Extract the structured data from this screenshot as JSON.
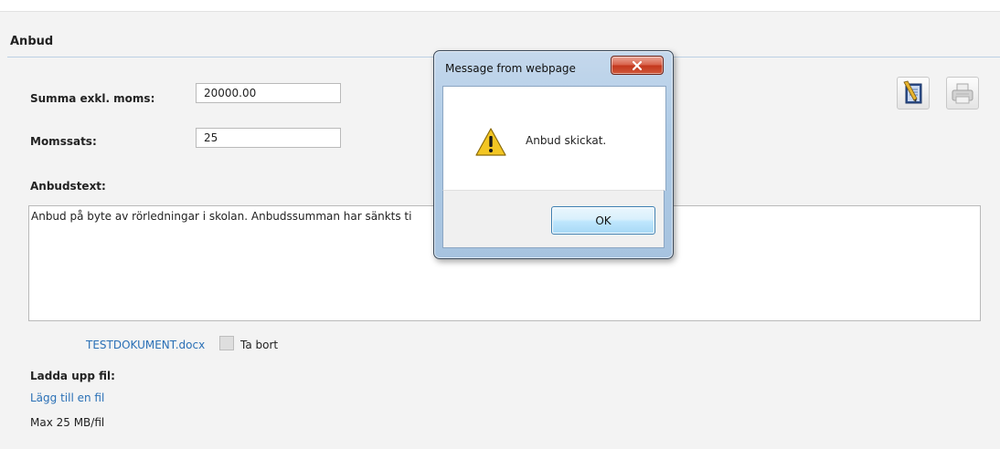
{
  "section": {
    "title": "Anbud"
  },
  "form": {
    "sum_label": "Summa exkl. moms:",
    "sum_value": "20000.00",
    "vat_label": "Momssats:",
    "vat_value": "25",
    "text_label": "Anbudstext:",
    "text_value": "Anbud på byte av rörledningar i skolan. Anbudssumman har sänkts ti"
  },
  "attachment": {
    "file_name": "TESTDOKUMENT.docx",
    "remove_label": "Ta bort",
    "remove_checked": false
  },
  "upload": {
    "label": "Ladda upp fil:",
    "add_link": "Lägg till en fil",
    "limit": "Max 25 MB/fil"
  },
  "toolbar": {
    "edit_icon": "document-edit-icon",
    "print_icon": "printer-icon"
  },
  "dialog": {
    "title": "Message from webpage",
    "message": "Anbud skickat.",
    "ok_label": "OK",
    "icon": "warning-icon",
    "close_icon": "close-icon"
  }
}
